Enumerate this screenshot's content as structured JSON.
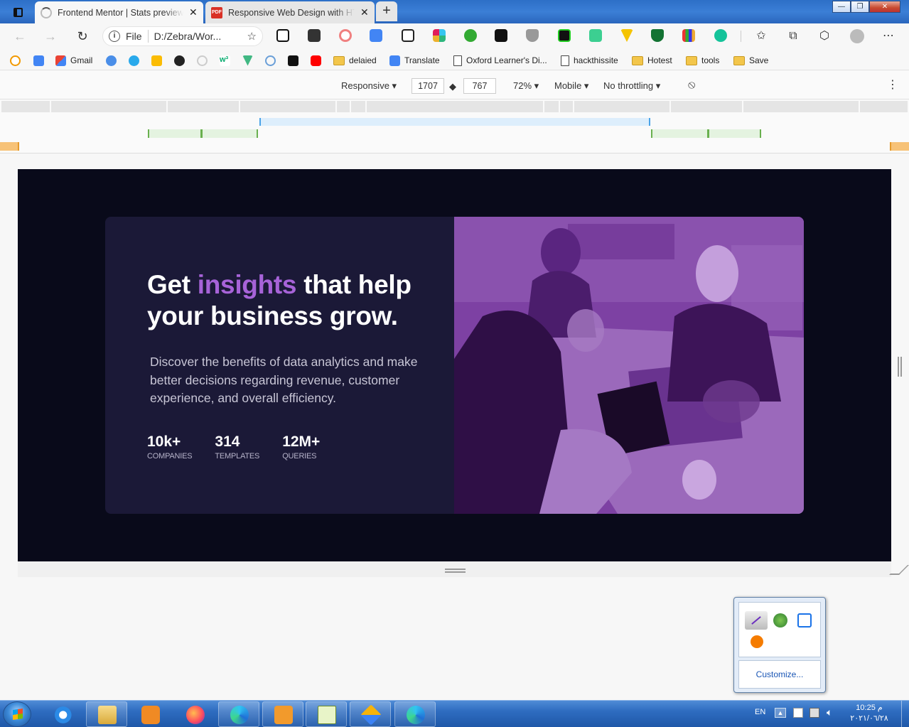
{
  "tabs": [
    {
      "title": "Frontend Mentor | Stats preview",
      "active": true
    },
    {
      "title": "Responsive Web Design with HTML",
      "active": false
    }
  ],
  "new_tab_label": "+",
  "window_controls": {
    "minimize": "—",
    "maximize": "❐",
    "close": "✕"
  },
  "address": {
    "scheme": "File",
    "url": "D:/Zebra/Wor..."
  },
  "bookmarks": [
    {
      "label": "Gmail",
      "icon": "gmail-icon"
    },
    {
      "label": "delaied",
      "icon": "folder-icon"
    },
    {
      "label": "Translate",
      "icon": "translate-icon"
    },
    {
      "label": "Oxford Learner's Di...",
      "icon": "page-icon"
    },
    {
      "label": "hackthissite",
      "icon": "page-icon"
    },
    {
      "label": "Hotest",
      "icon": "folder-icon"
    },
    {
      "label": "tools",
      "icon": "folder-icon"
    },
    {
      "label": "Save",
      "icon": "folder-icon"
    }
  ],
  "devtools": {
    "device": "Responsive",
    "width": "1707",
    "height": "767",
    "zoom": "72%",
    "device_type": "Mobile",
    "throttling": "No throttling"
  },
  "page": {
    "headline_pre": "Get ",
    "headline_accent": "insights",
    "headline_post": " that help your business grow.",
    "description": "Discover the benefits of data analytics and make better decisions regarding revenue, customer experience, and overall efficiency.",
    "stats": [
      {
        "value": "10k+",
        "label": "COMPANIES"
      },
      {
        "value": "314",
        "label": "TEMPLATES"
      },
      {
        "value": "12M+",
        "label": "QUERIES"
      }
    ],
    "colors": {
      "background": "#090a1a",
      "card": "#1b1937",
      "accent": "#a763d8",
      "image_tint": "#7b3fa1"
    }
  },
  "tray_popup": {
    "customize": "Customize..."
  },
  "taskbar": {
    "language": "EN",
    "time": "10:25 م",
    "date": "٢٠٢١/٠٦/٢٨"
  }
}
